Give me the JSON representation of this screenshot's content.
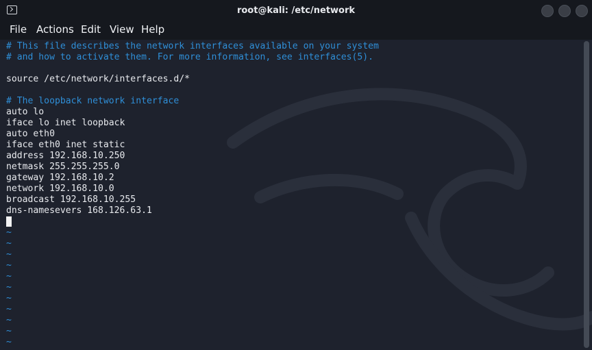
{
  "window": {
    "title": "root@kali: /etc/network"
  },
  "menu": {
    "items": [
      "File",
      "Actions",
      "Edit",
      "View",
      "Help"
    ]
  },
  "editor": {
    "lines": [
      {
        "text": "# This file describes the network interfaces available on your system",
        "kind": "comment"
      },
      {
        "text": "# and how to activate them. For more information, see interfaces(5).",
        "kind": "comment"
      },
      {
        "text": "",
        "kind": "text"
      },
      {
        "text": "source /etc/network/interfaces.d/*",
        "kind": "text"
      },
      {
        "text": "",
        "kind": "text"
      },
      {
        "text": "# The loopback network interface",
        "kind": "comment"
      },
      {
        "text": "auto lo",
        "kind": "text"
      },
      {
        "text": "iface lo inet loopback",
        "kind": "text"
      },
      {
        "text": "auto eth0",
        "kind": "text"
      },
      {
        "text": "iface eth0 inet static",
        "kind": "text"
      },
      {
        "text": "address 192.168.10.250",
        "kind": "text"
      },
      {
        "text": "netmask 255.255.255.0",
        "kind": "text"
      },
      {
        "text": "gateway 192.168.10.2",
        "kind": "text"
      },
      {
        "text": "network 192.168.10.0",
        "kind": "text"
      },
      {
        "text": "broadcast 192.168.10.255",
        "kind": "text"
      },
      {
        "text": "dns-namesevers 168.126.63.1",
        "kind": "text"
      }
    ],
    "empty_line_marker": "~",
    "empty_line_count": 11
  },
  "colors": {
    "background": "#1e222d",
    "titlebar": "#15181e",
    "comment": "#2f8fd8",
    "text": "#e8eaee"
  },
  "icons": {
    "app": "terminal-icon"
  }
}
